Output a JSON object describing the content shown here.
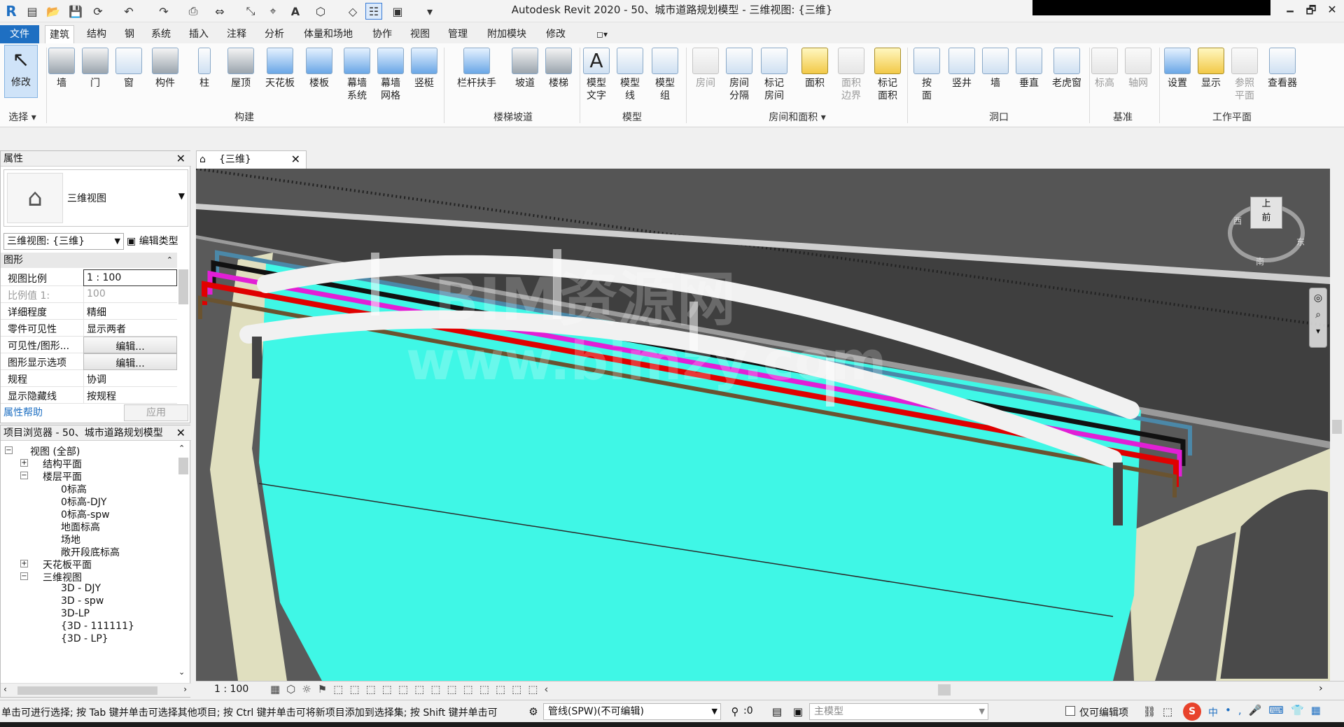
{
  "app": {
    "title": "Autodesk Revit 2020 - 50、城市道路规划模型 - 三维视图: {三维}",
    "logo": "R"
  },
  "window_controls": {
    "minimize": "🗕",
    "restore": "🗗",
    "close": "✕"
  },
  "tabs": [
    "文件",
    "建筑",
    "结构",
    "钢",
    "系统",
    "插入",
    "注释",
    "分析",
    "体量和场地",
    "协作",
    "视图",
    "管理",
    "附加模块",
    "修改"
  ],
  "ribbon": {
    "select": {
      "modify": "修改",
      "panel": "选择"
    },
    "build": {
      "wall": "墙",
      "door": "门",
      "window": "窗",
      "component": "构件",
      "column": "柱",
      "roof": "屋顶",
      "ceiling": "天花板",
      "floor": "楼板",
      "curtain_system": "幕墙\n系统",
      "curtain_grid": "幕墙\n网格",
      "mullion": "竖梃",
      "panel": "构建"
    },
    "circulation": {
      "railing": "栏杆扶手",
      "ramp": "坡道",
      "stair": "楼梯",
      "panel": "楼梯坡道"
    },
    "model": {
      "model_text": "模型\n文字",
      "model_line": "模型\n线",
      "model_group": "模型\n组",
      "panel": "模型"
    },
    "room_area": {
      "room": "房间",
      "room_separator": "房间\n分隔",
      "tag_room": "标记\n房间",
      "area": "面积",
      "area_boundary": "面积\n边界",
      "tag_area": "标记\n面积",
      "panel": "房间和面积"
    },
    "opening": {
      "by_face": "按\n面",
      "shaft": "竖井",
      "wall": "墙",
      "vertical": "垂直",
      "dormer": "老虎窗",
      "panel": "洞口"
    },
    "datum": {
      "level": "标高",
      "grid": "轴网",
      "panel": "基准"
    },
    "work_plane": {
      "set": "设置",
      "show": "显示",
      "ref_plane": "参照\n平面",
      "viewer": "查看器",
      "panel": "工作平面"
    }
  },
  "properties": {
    "title": "属性",
    "type_name": "三维视图",
    "view_selector": "三维视图: {三维}",
    "edit_type": "编辑类型",
    "group": "图形",
    "rows": [
      {
        "key": "视图比例",
        "value": "1 : 100"
      },
      {
        "key": "比例值 1:",
        "value": "100"
      },
      {
        "key": "详细程度",
        "value": "精细"
      },
      {
        "key": "零件可见性",
        "value": "显示两者"
      },
      {
        "key": "可见性/图形...",
        "value": "编辑..."
      },
      {
        "key": "图形显示选项",
        "value": "编辑..."
      },
      {
        "key": "规程",
        "value": "协调"
      },
      {
        "key": "显示隐藏线",
        "value": "按规程"
      }
    ],
    "help": "属性帮助",
    "apply": "应用"
  },
  "browser": {
    "title": "项目浏览器 - 50、城市道路规划模型",
    "items": [
      {
        "label": "视图 (全部)",
        "depth": 0,
        "toggle": "−"
      },
      {
        "label": "结构平面",
        "depth": 1,
        "toggle": "+"
      },
      {
        "label": "楼层平面",
        "depth": 1,
        "toggle": "−"
      },
      {
        "label": "0标高",
        "depth": 2,
        "toggle": ""
      },
      {
        "label": "0标高-DJY",
        "depth": 2,
        "toggle": ""
      },
      {
        "label": "0标高-spw",
        "depth": 2,
        "toggle": ""
      },
      {
        "label": "地面标高",
        "depth": 2,
        "toggle": ""
      },
      {
        "label": "场地",
        "depth": 2,
        "toggle": ""
      },
      {
        "label": "敞开段底标高",
        "depth": 2,
        "toggle": ""
      },
      {
        "label": "天花板平面",
        "depth": 1,
        "toggle": "+"
      },
      {
        "label": "三维视图",
        "depth": 1,
        "toggle": "−"
      },
      {
        "label": "3D - DJY",
        "depth": 2,
        "toggle": ""
      },
      {
        "label": "3D - spw",
        "depth": 2,
        "toggle": ""
      },
      {
        "label": "3D-LP",
        "depth": 2,
        "toggle": ""
      },
      {
        "label": "{3D - 111111}",
        "depth": 2,
        "toggle": ""
      },
      {
        "label": "{3D - LP}",
        "depth": 2,
        "toggle": ""
      }
    ]
  },
  "view_tab": {
    "label": "{三维}"
  },
  "view_control": {
    "scale": "1 : 100"
  },
  "watermark": {
    "line1": "BIM资源网",
    "line2": "www.bimzy.com"
  },
  "viewcube": {
    "top": "上",
    "front": "前",
    "south": "南",
    "east": "东",
    "west": "西"
  },
  "status": {
    "message": "单击可进行选择; 按 Tab 键并单击可选择其他项目; 按 Ctrl 键并单击可将新项目添加到选择集; 按 Shift 键并单击可",
    "workset": "管线(SPW)(不可编辑)",
    "count": ":0",
    "design_option": "主模型",
    "editable_only": "仅可编辑项",
    "ime": "中"
  },
  "colors": {
    "cyan_surface": "#3ff7e6",
    "dark_surface": "#4c4c4c",
    "pipe_black": "#111111",
    "pipe_magenta": "#e21fd6",
    "pipe_red": "#e00000",
    "pipe_brown": "#6a5330",
    "pipe_steel": "#4b88a8",
    "file_tab": "#1e6fc2"
  }
}
